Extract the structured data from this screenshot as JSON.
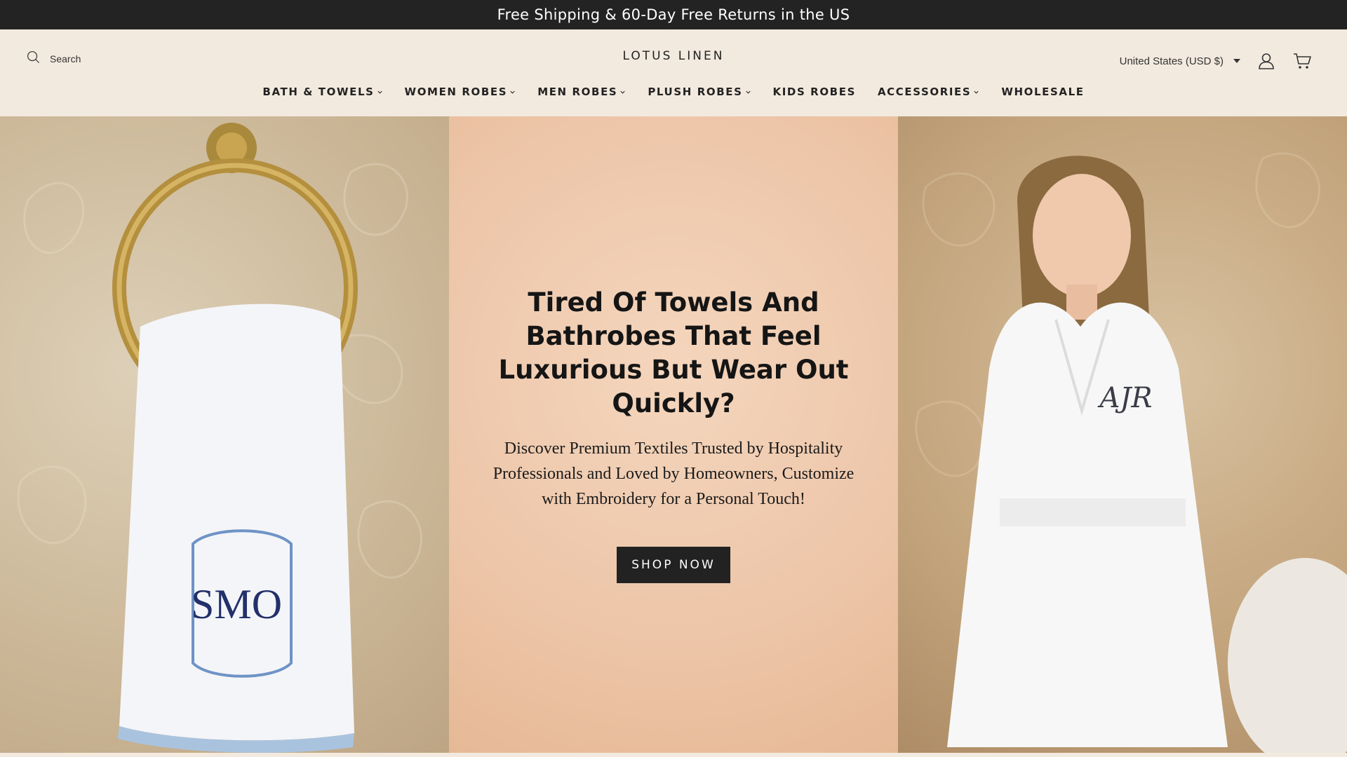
{
  "announcement": "Free Shipping & 60-Day Free Returns in the US",
  "header": {
    "search_label": "Search",
    "logo": "LOTUS LINEN",
    "country_label": "United States (USD $)",
    "account_icon": "user-icon",
    "cart_icon": "cart-icon",
    "search_icon": "search-icon"
  },
  "nav": {
    "items": [
      {
        "label": "BATH & TOWELS",
        "dropdown": true
      },
      {
        "label": "WOMEN ROBES",
        "dropdown": true
      },
      {
        "label": "MEN ROBES",
        "dropdown": true
      },
      {
        "label": "PLUSH ROBES",
        "dropdown": true
      },
      {
        "label": "KIDS ROBES",
        "dropdown": false
      },
      {
        "label": "ACCESSORIES",
        "dropdown": true
      },
      {
        "label": "WHOLESALE",
        "dropdown": false
      }
    ]
  },
  "hero": {
    "title": "Tired Of Towels And Bathrobes That Feel Luxurious But Wear Out Quickly?",
    "subtitle": "Discover Premium Textiles Trusted by Hospitality Professionals and Loved by Homeowners, Customize with Embroidery for a Personal Touch!",
    "cta_label": "SHOP NOW",
    "towel_monogram": "SMO",
    "robe_monogram": "AJR"
  },
  "colors": {
    "announcement_bg": "#232323",
    "header_bg": "#f3eadf",
    "button_bg": "#222222",
    "center_panel": "#edc5a8"
  }
}
